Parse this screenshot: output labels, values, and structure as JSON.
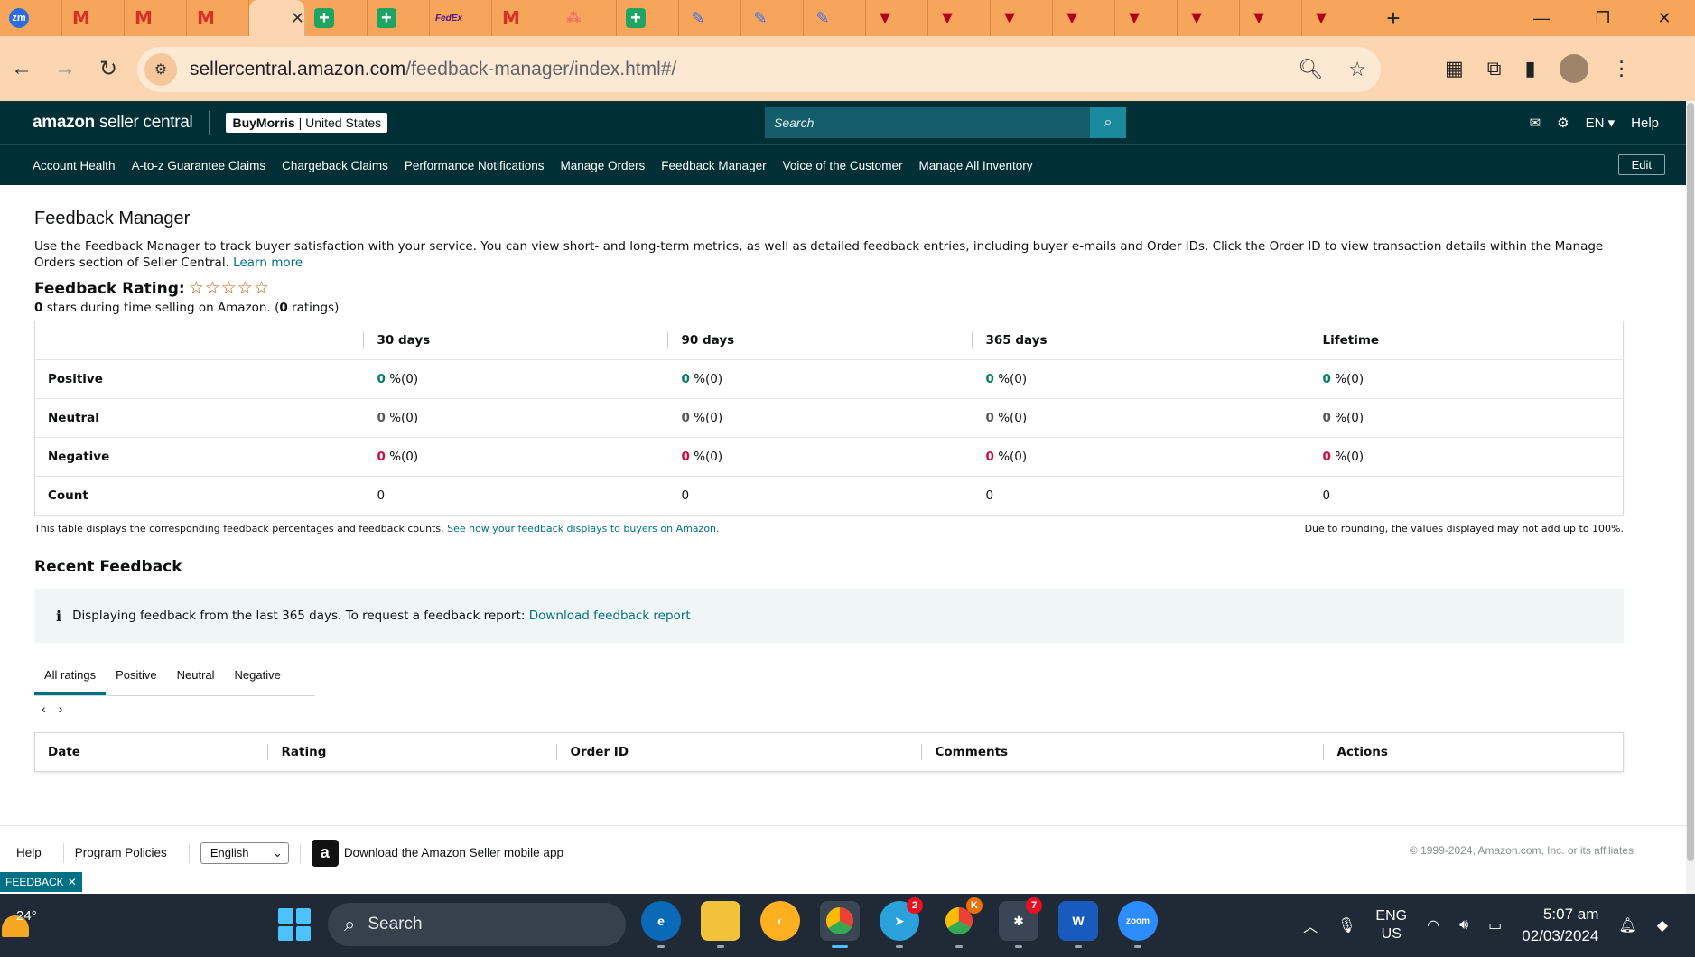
{
  "browser": {
    "tabs": [
      {
        "icon": "zoom-icon",
        "label": "zm"
      },
      {
        "icon": "gmail-icon",
        "label": "M"
      },
      {
        "icon": "gmail-icon",
        "label": "M"
      },
      {
        "icon": "gmail-icon",
        "label": "M"
      },
      {
        "icon": "amazon-icon",
        "label": ""
      },
      {
        "icon": "sheets-icon",
        "label": "+"
      },
      {
        "icon": "sheets-icon",
        "label": "+"
      },
      {
        "icon": "fedex-icon",
        "label": "FedEx"
      },
      {
        "icon": "gmail-icon",
        "label": "M"
      },
      {
        "icon": "asana-icon",
        "label": "⁂"
      },
      {
        "icon": "sheets-icon",
        "label": "+"
      },
      {
        "icon": "pen-icon",
        "label": "✎"
      },
      {
        "icon": "pen-icon",
        "label": "✎"
      },
      {
        "icon": "pen-icon",
        "label": "✎"
      },
      {
        "icon": "flag-icon",
        "label": "▼"
      },
      {
        "icon": "flag-icon",
        "label": "▼"
      },
      {
        "icon": "flag-icon",
        "label": "▼"
      },
      {
        "icon": "flag-icon",
        "label": "▼"
      },
      {
        "icon": "flag-icon",
        "label": "▼"
      },
      {
        "icon": "flag-icon",
        "label": "▼"
      },
      {
        "icon": "flag-icon",
        "label": "▼"
      },
      {
        "icon": "flag-icon",
        "label": "▼"
      }
    ],
    "url_host": "sellercentral.amazon.com",
    "url_path": "/feedback-manager/index.html#/"
  },
  "header": {
    "logo_bold": "amazon",
    "logo_light": " seller central",
    "store_name": "BuyMorris",
    "store_region": "United States",
    "search_placeholder": "Search",
    "language": "EN",
    "help": "Help"
  },
  "nav": {
    "items": [
      "Account Health",
      "A-to-z Guarantee Claims",
      "Chargeback Claims",
      "Performance Notifications",
      "Manage Orders",
      "Feedback Manager",
      "Voice of the Customer",
      "Manage All Inventory"
    ],
    "edit": "Edit"
  },
  "page": {
    "title": "Feedback Manager",
    "description": "Use the Feedback Manager to track buyer satisfaction with your service. You can view short- and long-term metrics, as well as detailed feedback entries, including buyer e-mails and Order IDs. Click the Order ID to view transaction details within the Manage Orders section of Seller Central.",
    "learn_more": "Learn more",
    "rating_label": "Feedback Rating:",
    "stars": "☆☆☆☆☆",
    "stars_count": "0",
    "rating_text_mid": " stars during time selling on Amazon. (",
    "ratings_count": "0",
    "rating_text_end": " ratings)"
  },
  "feedback_table": {
    "headers": [
      "",
      "30 days",
      "90 days",
      "365 days",
      "Lifetime"
    ],
    "rows": [
      {
        "label": "Positive",
        "cells": [
          [
            "0",
            " %(0)"
          ],
          [
            "0",
            " %(0)"
          ],
          [
            "0",
            " %(0)"
          ],
          [
            "0",
            " %(0)"
          ]
        ]
      },
      {
        "label": "Neutral",
        "cells": [
          [
            "0",
            " %(0)"
          ],
          [
            "0",
            " %(0)"
          ],
          [
            "0",
            " %(0)"
          ],
          [
            "0",
            " %(0)"
          ]
        ]
      },
      {
        "label": "Negative",
        "cells": [
          [
            "0",
            " %(0)"
          ],
          [
            "0",
            " %(0)"
          ],
          [
            "0",
            " %(0)"
          ],
          [
            "0",
            " %(0)"
          ]
        ]
      },
      {
        "label": "Count",
        "cells": [
          [
            "0"
          ],
          [
            "0"
          ],
          [
            "0"
          ],
          [
            "0"
          ]
        ]
      }
    ],
    "note_left": "This table displays the corresponding feedback percentages and feedback counts.",
    "note_link": "See how your feedback displays to buyers on Amazon.",
    "note_right": "Due to rounding, the values displayed may not add up to 100%."
  },
  "recent": {
    "title": "Recent Feedback",
    "info_icon": "i",
    "info_text": "Displaying feedback from the last 365 days. To request a feedback report:",
    "info_link": "Download feedback report",
    "tabs": [
      "All ratings",
      "Positive",
      "Neutral",
      "Negative"
    ],
    "pager_prev": "‹",
    "pager_next": "›",
    "columns": [
      "Date",
      "Rating",
      "Order ID",
      "Comments",
      "Actions"
    ]
  },
  "footer": {
    "help": "Help",
    "program_policies": "Program Policies",
    "language_value": "English",
    "app_text": "Download the Amazon Seller mobile app",
    "copyright": "© 1999-2024, Amazon.com, Inc. or its affiliates",
    "feedback_tab": "FEEDBACK"
  },
  "taskbar": {
    "temperature": "24°",
    "search_label": "Search",
    "telegram_badge": "2",
    "chrome_badge": "K",
    "slack_badge": "7",
    "lang_top": "ENG",
    "lang_bottom": "US",
    "time": "5:07 am",
    "date": "02/03/2024"
  },
  "colors": {
    "positive": "#067d62",
    "negative": "#cc0c39",
    "link": "#007185",
    "header_bg": "#002f36",
    "browser_tab_bg": "#f6a55a"
  }
}
